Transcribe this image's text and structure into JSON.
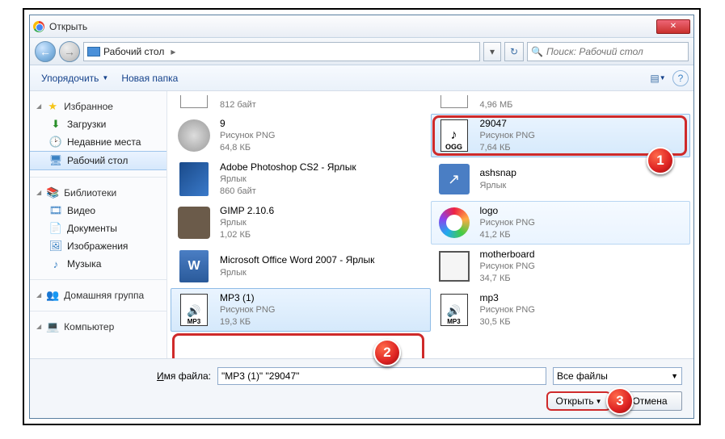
{
  "window": {
    "title": "Открыть"
  },
  "nav": {
    "location": "Рабочий стол",
    "search_placeholder": "Поиск: Рабочий стол"
  },
  "toolbar": {
    "organize": "Упорядочить",
    "newfolder": "Новая папка"
  },
  "sidebar": {
    "fav": {
      "head": "Избранное",
      "downloads": "Загрузки",
      "recent": "Недавние места",
      "desktop": "Рабочий стол"
    },
    "lib": {
      "head": "Библиотеки",
      "video": "Видео",
      "docs": "Документы",
      "pics": "Изображения",
      "music": "Музыка"
    },
    "home": {
      "head": "Домашняя группа"
    },
    "comp": {
      "head": "Компьютер"
    }
  },
  "files": {
    "left": [
      {
        "name": "",
        "type": "",
        "size": "812 байт",
        "icon": "genericpng"
      },
      {
        "name": "9",
        "type": "Рисунок PNG",
        "size": "64,8 КБ",
        "icon": "gear"
      },
      {
        "name": "Adobe Photoshop CS2 - Ярлык",
        "type": "Ярлык",
        "size": "860 байт",
        "icon": "feather"
      },
      {
        "name": "GIMP 2.10.6",
        "type": "Ярлык",
        "size": "1,02 КБ",
        "icon": "gimp"
      },
      {
        "name": "Microsoft Office Word 2007 - Ярлык",
        "type": "Ярлык",
        "size": "",
        "icon": "docx"
      },
      {
        "name": "MP3 (1)",
        "type": "Рисунок PNG",
        "size": "19,3 КБ",
        "icon": "mp3ico",
        "sel": true
      }
    ],
    "right": [
      {
        "name": "",
        "type": "",
        "size": "4,96 МБ",
        "icon": "genericpng"
      },
      {
        "name": "29047",
        "type": "Рисунок PNG",
        "size": "7,64 КБ",
        "icon": "oggico",
        "sel": true
      },
      {
        "name": "ashsnap",
        "type": "Ярлык",
        "size": "",
        "icon": "snap"
      },
      {
        "name": "logo",
        "type": "Рисунок PNG",
        "size": "41,2 КБ",
        "icon": "ring",
        "hover": true
      },
      {
        "name": "motherboard",
        "type": "Рисунок PNG",
        "size": "34,7 КБ",
        "icon": "chip"
      },
      {
        "name": "mp3",
        "type": "Рисунок PNG",
        "size": "30,5 КБ",
        "icon": "mp3ico"
      }
    ]
  },
  "footer": {
    "label": "Имя файла:",
    "value": "\"MP3 (1)\" \"29047\"",
    "filter": "Все файлы",
    "open": "Открыть",
    "cancel": "Отмена"
  },
  "annotations": {
    "n1": "1",
    "n2": "2",
    "n3": "3"
  }
}
